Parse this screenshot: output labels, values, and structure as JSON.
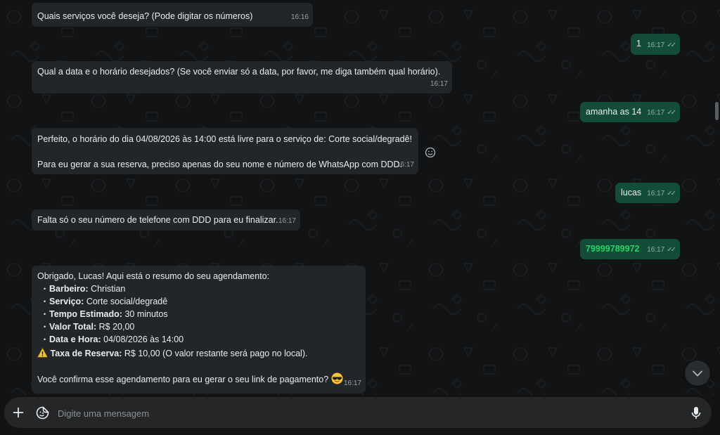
{
  "messages": {
    "m1": {
      "text": "Quais serviços você deseja? (Pode digitar os números)",
      "time": "16:16"
    },
    "m2": {
      "text": "1",
      "time": "16:17"
    },
    "m3": {
      "text": "Qual a data e o horário desejados? (Se você enviar só a data, por favor, me diga também qual horário).",
      "time": "16:17"
    },
    "m4": {
      "text": "amanha as 14",
      "time": "16:17"
    },
    "m5": {
      "line1": "Perfeito, o horário do dia 04/08/2026 às 14:00 está livre para o serviço de: Corte social/degradê!",
      "line2": "Para eu gerar a sua reserva, preciso apenas do seu nome e número de WhatsApp com DDD.",
      "time": "16:17"
    },
    "m6": {
      "text": "lucas",
      "time": "16:17"
    },
    "m7": {
      "text": "Falta só o seu número de telefone com DDD para eu finalizar.",
      "time": "16:17"
    },
    "m8": {
      "text": "79999789972",
      "time": "16:17"
    },
    "m9": {
      "intro": "Obrigado, Lucas! Aqui está o resumo do seu agendamento:",
      "items": [
        {
          "label": "Barbeiro:",
          "value": "Christian"
        },
        {
          "label": "Serviço:",
          "value": "Corte social/degradê"
        },
        {
          "label": "Tempo Estimado:",
          "value": "30 minutos"
        },
        {
          "label": "Valor Total:",
          "value": "R$ 20,00"
        },
        {
          "label": "Data e Hora:",
          "value": "04/08/2026 às 14:00"
        }
      ],
      "fee_label": "Taxa de Reserva:",
      "fee_value": "R$ 10,00 (O valor restante será pago no local).",
      "question": "Você confirma esse agendamento para eu gerar o seu link de pagamento?",
      "time": "16:17"
    }
  },
  "composer": {
    "placeholder": "Digite uma mensagem"
  },
  "icons": {
    "attach": "plus-icon",
    "sticker": "sticker-icon",
    "mic": "microphone-icon",
    "scroll": "chevron-down-icon",
    "react": "smiley-icon",
    "warning": "warning-icon",
    "cool": "sunglasses-emoji-icon"
  },
  "colors": {
    "incoming_bubble": "#232628",
    "outgoing_bubble": "#144d37",
    "phone_link": "#25d366",
    "background": "#111315"
  }
}
